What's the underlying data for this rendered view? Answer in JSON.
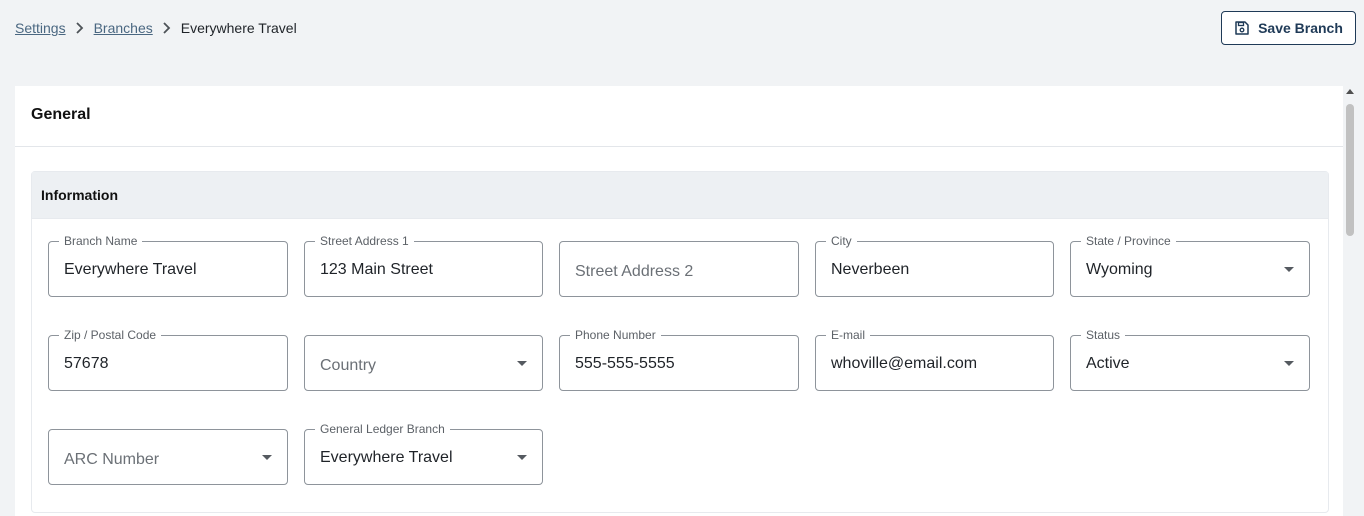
{
  "breadcrumb": {
    "items": [
      {
        "label": "Settings"
      },
      {
        "label": "Branches"
      },
      {
        "label": "Everywhere Travel"
      }
    ]
  },
  "toolbar": {
    "save_label": "Save Branch"
  },
  "card": {
    "title": "General"
  },
  "section": {
    "title": "Information"
  },
  "fields": {
    "branch_name": {
      "label": "Branch Name",
      "value": "Everywhere Travel"
    },
    "street1": {
      "label": "Street Address 1",
      "value": "123 Main Street"
    },
    "street2": {
      "placeholder": "Street Address 2"
    },
    "city": {
      "label": "City",
      "value": "Neverbeen"
    },
    "state": {
      "label": "State / Province",
      "value": "Wyoming"
    },
    "zip": {
      "label": "Zip / Postal Code",
      "value": "57678"
    },
    "country": {
      "placeholder": "Country"
    },
    "phone": {
      "label": "Phone Number",
      "value": "555-555-5555"
    },
    "email": {
      "label": "E-mail",
      "value": "whoville@email.com"
    },
    "status": {
      "label": "Status",
      "value": "Active"
    },
    "arc": {
      "placeholder": "ARC Number"
    },
    "gl_branch": {
      "label": "General Ledger Branch",
      "value": "Everywhere Travel"
    }
  },
  "icons": {
    "save": "floppy-disk-icon",
    "separator": "chevron-right-icon",
    "dropdown": "caret-down-icon"
  },
  "colors": {
    "accent": "#1f3a57",
    "link": "#4a6781",
    "background": "#f1f3f5"
  }
}
